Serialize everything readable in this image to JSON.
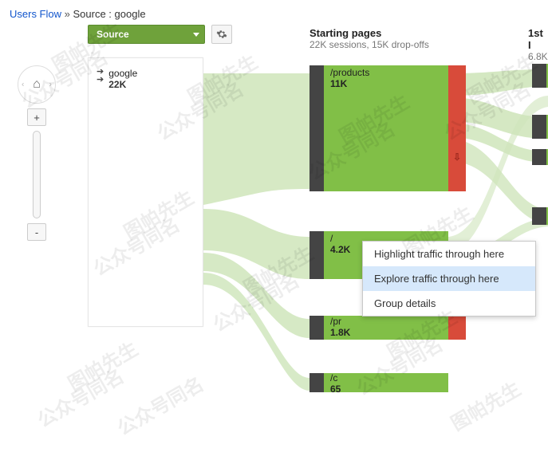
{
  "breadcrumb": {
    "root": "Users Flow",
    "sep": "»",
    "current": "Source : google"
  },
  "dropdown": {
    "label": "Source"
  },
  "source": {
    "name": "google",
    "count": "22K"
  },
  "columns": {
    "start": {
      "title": "Starting pages",
      "sub": "22K sessions, 15K drop-offs"
    },
    "first": {
      "title": "1st I",
      "sub": "6.8K"
    }
  },
  "nodes": {
    "n1": {
      "path": "/products",
      "count": "11K"
    },
    "n2": {
      "path": "/",
      "count": "4.2K"
    },
    "n3": {
      "path": "/pr",
      "count": "1.8K"
    },
    "n4": {
      "path": "/c",
      "count": "65"
    }
  },
  "context_menu": {
    "opt1": "Highlight traffic through here",
    "opt2": "Explore traffic through here",
    "opt3": "Group details"
  },
  "zoom": {
    "plus": "+",
    "minus": "-",
    "home": "⌂"
  },
  "watermarks": [
    "图帕先生",
    "公众号同名"
  ]
}
